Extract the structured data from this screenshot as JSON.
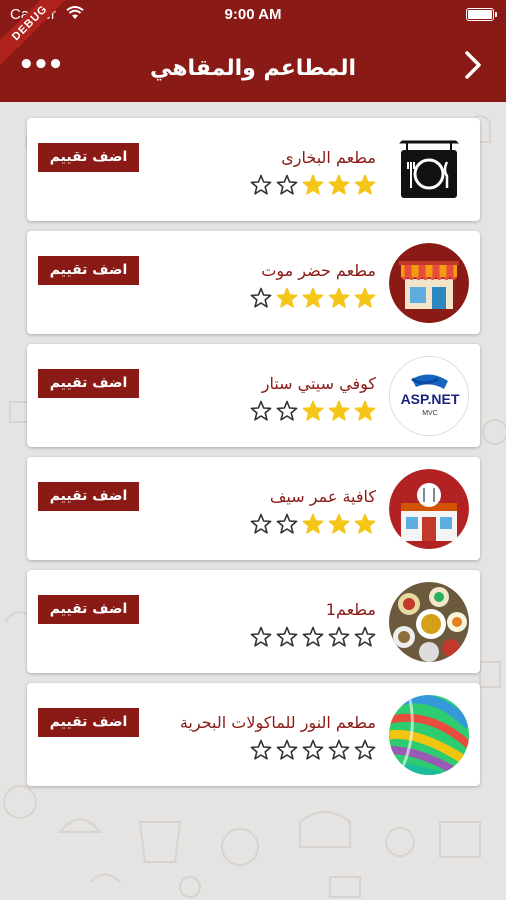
{
  "status_bar": {
    "carrier": "Carrier",
    "time": "9:00 AM"
  },
  "debug_label": "DEBUG",
  "header": {
    "title": "المطاعم والمقاهي"
  },
  "rate_button_label": "اضف تقييم",
  "colors": {
    "brand": "#8a1a15",
    "star_filled": "#f5c518",
    "background": "#e6e4e2"
  },
  "restaurants": [
    {
      "name": "مطعم البخارى",
      "rating": 3,
      "max_rating": 5,
      "avatar": "plate-fork-knife-sign"
    },
    {
      "name": "مطعم حضر موت",
      "rating": 4,
      "max_rating": 5,
      "avatar": "storefront-awning"
    },
    {
      "name": "كوفي سيتي ستار",
      "rating": 3,
      "max_rating": 5,
      "avatar": "asp-net-mvc-logo",
      "avatar_text": "ASP.NET",
      "avatar_subtext": "MVC"
    },
    {
      "name": "كافية عمر سيف",
      "rating": 3,
      "max_rating": 5,
      "avatar": "restaurant-building"
    },
    {
      "name": "مطعم1",
      "rating": 0,
      "max_rating": 5,
      "avatar": "food-dishes-photo"
    },
    {
      "name": "مطعم النور للماكولات البحرية",
      "rating": 0,
      "max_rating": 5,
      "avatar": "colorful-abstract-photo"
    }
  ]
}
